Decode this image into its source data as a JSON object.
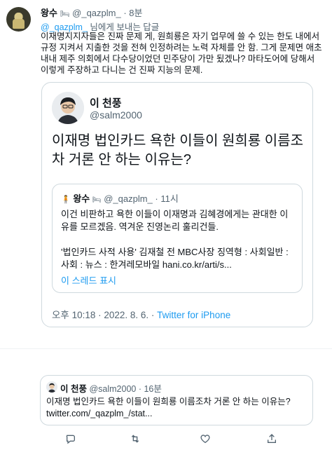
{
  "tweet": {
    "display_name": "왕수",
    "handle": "@_qazplm_",
    "time": "· 8분",
    "reply_prefix": "@_qazplm_",
    "reply_suffix": " 님에게 보내는 답글",
    "text": "이재명지지자들은 진짜 문제 게, 원희룡은 자기 업무에 쓸 수 있는 한도 내에서 규정 지켜서 지출한 것을 전혀 인정하려는 노력 자체를 안 함. 그게 문제면 애초 내내 제주 의회에서 다수당이었던 민주당이 가만 됬겠나? 마타도어에 당해서 이렇게 주장하고 다니는 건 진짜 지능의 문제."
  },
  "quoted": {
    "display_name": "이 천풍",
    "handle": "@salm2000",
    "text": "이재명 법인카드 욕한 이들이 원희룡 이름조차 거론 안 하는 이유는?",
    "meta": "오후 10:18 · 2022. 8. 6. · ",
    "source": "Twitter for iPhone",
    "inner": {
      "display_name": "왕수",
      "handle": "@_qazplm_",
      "time": "· 11시",
      "text": "이건 비판하고 욕한 이들이 이재명과 김혜경에게는 관대한 이유를 모르겠음. 역겨운 진영논리 훌리건들.",
      "link_text": "'법인카드 사적 사용' 김재철 전 MBC사장 징역형 : 사회일반 : 사회 : 뉴스 : 한겨레모바일 hani.co.kr/arti/s...",
      "thread_label": "이 스레드 표시"
    }
  },
  "reply_preview": {
    "display_name": "이 천풍",
    "handle": "@salm2000",
    "time": "· 16분",
    "text": "이재명 법인카드 욕한 이들이 원희룡 이름조차 거론 안 하는 이유는?",
    "link": "twitter.com/_qazplm_/stat..."
  },
  "actions": {
    "reply_icon": "reply-icon",
    "retweet_icon": "retweet-icon",
    "like_icon": "like-icon",
    "share_icon": "share-icon"
  }
}
